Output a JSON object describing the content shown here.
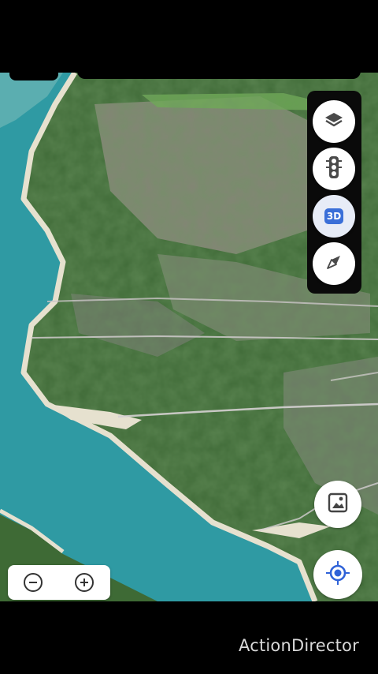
{
  "map": {
    "view_mode": "satellite-3d",
    "colors": {
      "water": "#2f9aa3",
      "forest": "#3f6a3a",
      "sand": "#e6e1cf",
      "clearing": "#9a8f8f"
    }
  },
  "controls": {
    "layers_icon": "layers-icon",
    "traffic_icon": "traffic-light-icon",
    "three_d_label": "3D",
    "compass_icon": "compass-icon",
    "imagery_icon": "image-frame-icon",
    "locate_icon": "my-location-icon",
    "zoom_out_icon": "minus-icon",
    "zoom_in_icon": "plus-icon",
    "accent": "#3a6fd8"
  },
  "watermark": {
    "text": "ActionDirector"
  }
}
